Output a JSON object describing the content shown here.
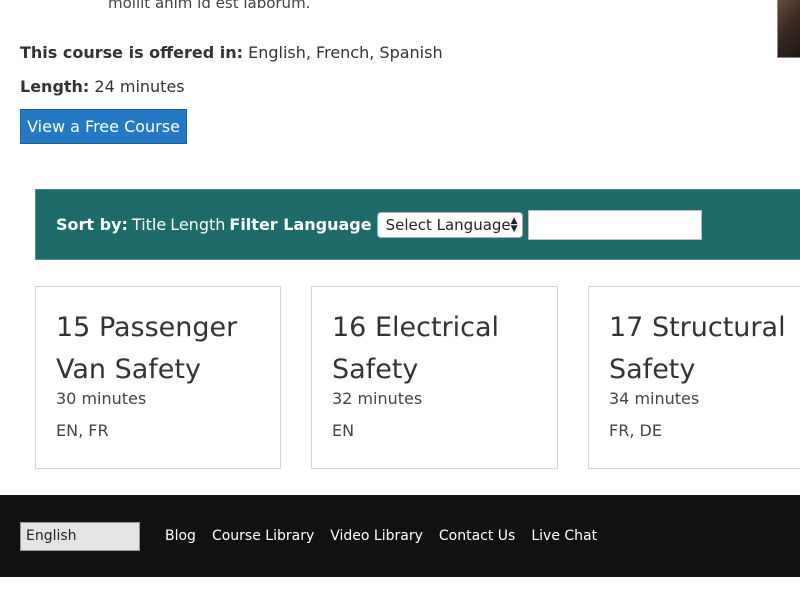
{
  "intro": {
    "tail_text": "mollit anim id est laborum."
  },
  "course_info": {
    "languages_label": "This course is offered in:",
    "languages_value": "English, French, Spanish",
    "length_label": "Length:",
    "length_value": "24 minutes",
    "free_course_button": "View a Free Course"
  },
  "filter_bar": {
    "sort_label": "Sort by:",
    "sort_title": "Title",
    "sort_length": "Length",
    "filter_label": "Filter Language",
    "select_value": "Select Language",
    "search_value": ""
  },
  "courses": [
    {
      "title": "15 Passenger Van Safety",
      "length": "30 minutes",
      "languages": "EN, FR"
    },
    {
      "title": "16 Electrical Safety",
      "length": "32 minutes",
      "languages": "EN"
    },
    {
      "title": "17 Structural Safety",
      "length": "34 minutes",
      "languages": "FR, DE"
    }
  ],
  "footer": {
    "language_select": "English",
    "links": [
      "Blog",
      "Course Library",
      "Video Library",
      "Contact Us",
      "Live Chat"
    ]
  },
  "colors": {
    "filter_bar_bg": "#1f6a6a",
    "button_bg": "#2478c4",
    "footer_bg": "#111111"
  }
}
